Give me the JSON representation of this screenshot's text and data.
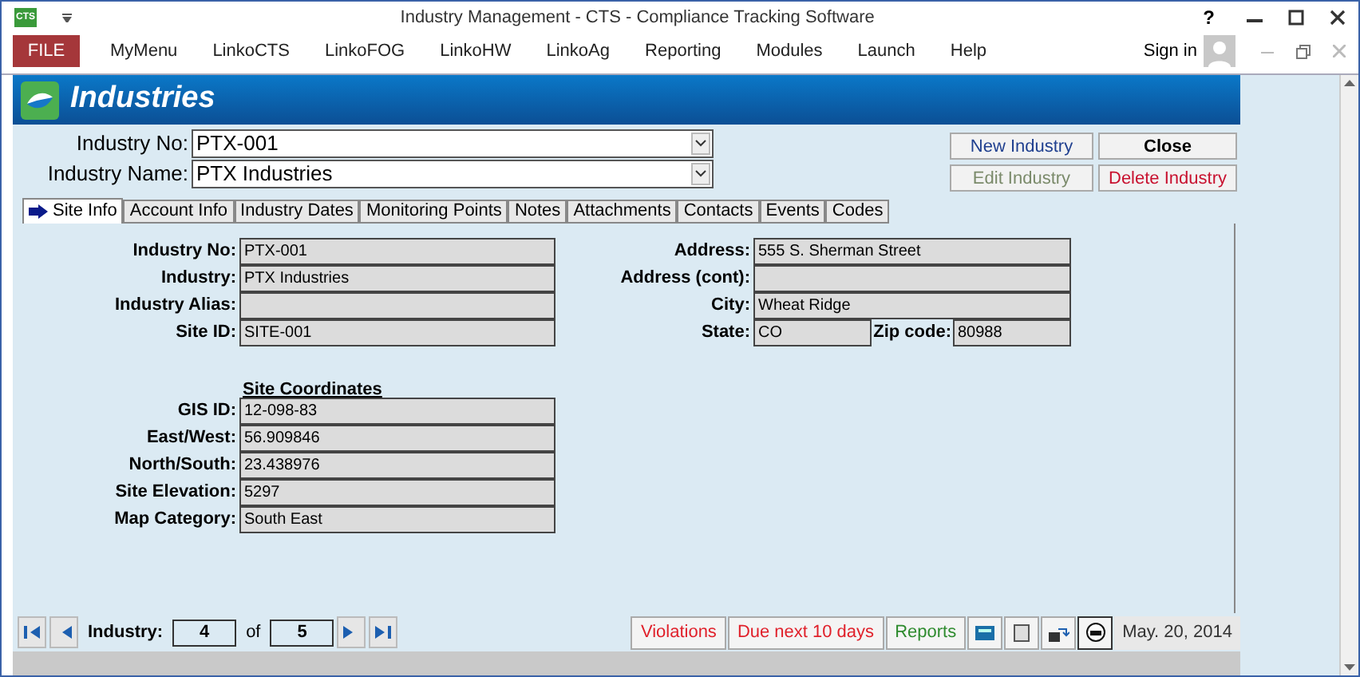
{
  "window": {
    "app_icon": "CTS",
    "title": "Industry Management - CTS - Compliance Tracking Software",
    "help": "?"
  },
  "menu": [
    {
      "label": "FILE",
      "kind": "file"
    },
    {
      "label": "MyMenu",
      "kind": "item"
    },
    {
      "label": "LinkoCTS",
      "kind": "item"
    },
    {
      "label": "LinkoFOG",
      "kind": "item"
    },
    {
      "label": "LinkoHW",
      "kind": "item"
    },
    {
      "label": "LinkoAg",
      "kind": "item"
    },
    {
      "label": "Reporting",
      "kind": "item"
    },
    {
      "label": "Modules",
      "kind": "item"
    },
    {
      "label": "Launch",
      "kind": "item"
    },
    {
      "label": "Help",
      "kind": "item"
    }
  ],
  "sign_in": "Sign in",
  "form": {
    "title": "Industries",
    "selectors": [
      {
        "label": "Industry No:",
        "value": "PTX-001"
      },
      {
        "label": "Industry Name:",
        "value": "PTX Industries"
      }
    ],
    "buttons": [
      {
        "label": "New Industry",
        "kind": "primary",
        "disabled": false
      },
      {
        "label": "Close",
        "kind": "plain",
        "disabled": false
      },
      {
        "label": "Edit Industry",
        "kind": "primary",
        "disabled": true
      },
      {
        "label": "Delete Industry",
        "kind": "danger",
        "disabled": false
      }
    ],
    "tabs": [
      {
        "label": "Site Info",
        "selected": true
      },
      {
        "label": "Account Info",
        "selected": false
      },
      {
        "label": "Industry Dates",
        "selected": false
      },
      {
        "label": "Monitoring Points",
        "selected": false
      },
      {
        "label": "Notes",
        "selected": false
      },
      {
        "label": "Attachments",
        "selected": false
      },
      {
        "label": "Contacts",
        "selected": false
      },
      {
        "label": "Events",
        "selected": false
      },
      {
        "label": "Codes",
        "selected": false
      }
    ],
    "site_info": {
      "left_fields": [
        {
          "label": "Industry No:",
          "value": "PTX-001"
        },
        {
          "label": "Industry:",
          "value": "PTX Industries"
        },
        {
          "label": "Industry Alias:"
        },
        {
          "label": "Site ID:",
          "value": "SITE-001"
        }
      ],
      "right_fields": [
        {
          "label": "Address:",
          "value": "555 S. Sherman Street"
        },
        {
          "label": "Address (cont):"
        },
        {
          "label": "City:",
          "value": "Wheat Ridge"
        }
      ],
      "state": {
        "label": "State:",
        "value": "CO",
        "zip_label": "Zip code:",
        "zip_value": "80988"
      },
      "coordinates": {
        "title": "Site Coordinates",
        "fields": [
          {
            "label": "GIS ID:",
            "value": "12-098-83"
          },
          {
            "label": "East/West:",
            "value": "56.909846"
          },
          {
            "label": "North/South:",
            "value": "23.438976"
          },
          {
            "label": "Site Elevation:",
            "value": "5297"
          },
          {
            "label": "Map Category:",
            "value": "South East"
          }
        ]
      }
    },
    "navigation": {
      "label": "Industry:",
      "current": "4",
      "of": "of",
      "total": "5"
    },
    "footer_buttons": [
      {
        "label": "Violations",
        "color": "#e0202a"
      },
      {
        "label": "Due next 10 days",
        "color": "#e0202a"
      },
      {
        "label": "Reports",
        "color": "#2e8b2e"
      }
    ],
    "date": "May. 20, 2014"
  }
}
